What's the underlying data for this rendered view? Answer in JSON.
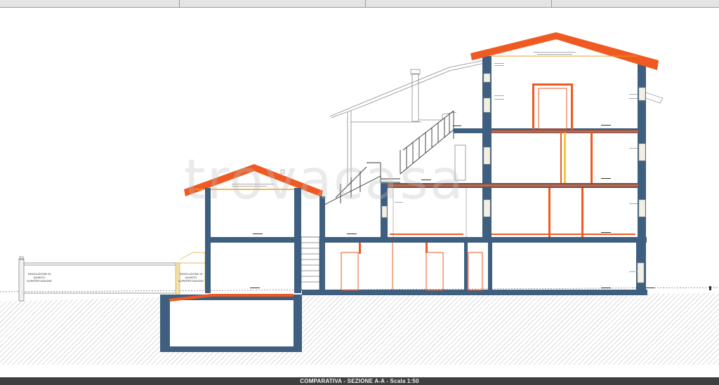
{
  "footer": {
    "caption": "COMPARATIVA - SEZIONE A-A - Scala 1:50"
  },
  "watermark": "trovacasa",
  "annotations": {
    "demolition_left": "DEMOLIZIONE IN QUANTO SUPERFETAZIONE",
    "demolition_right": "DEMOLIZIONE IN QUANTO SUPERFETAZIONE"
  },
  "colors": {
    "structure": "#3e5f7f",
    "new_work": "#ee5a22",
    "accent": "#f6c543",
    "ground_hatch": "#b8b8b8"
  }
}
